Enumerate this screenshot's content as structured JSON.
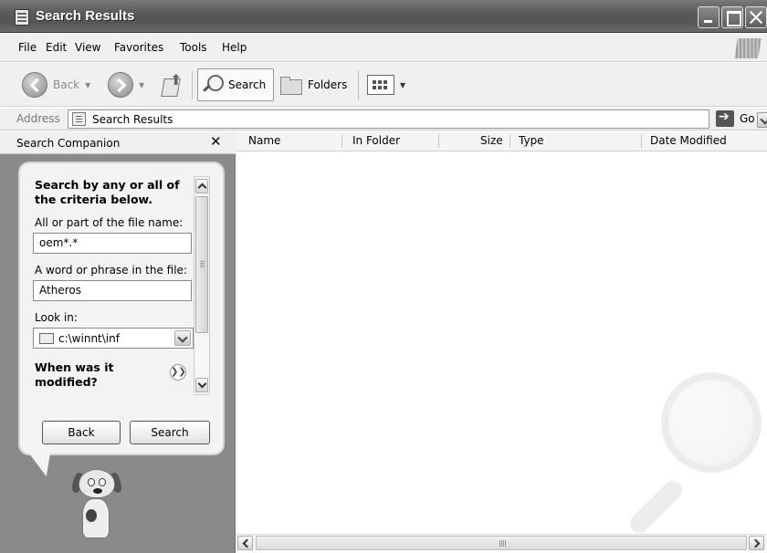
{
  "window": {
    "title": "Search Results"
  },
  "menu": {
    "items": [
      {
        "label": "File"
      },
      {
        "label": "Edit"
      },
      {
        "label": "View"
      },
      {
        "label": "Favorites"
      },
      {
        "label": "Tools"
      },
      {
        "label": "Help"
      }
    ]
  },
  "toolbar": {
    "back_label": "Back",
    "search_label": "Search",
    "folders_label": "Folders"
  },
  "address": {
    "label": "Address",
    "value": "Search Results",
    "go_label": "Go"
  },
  "panel": {
    "title": "Search Companion",
    "close_label": "✕",
    "criteria_title": "Search by any or all of the criteria below.",
    "filename_label": "All or part of the file name:",
    "filename_value": "oem*.*",
    "phrase_label": "A word or phrase in the file:",
    "phrase_value": "Atheros",
    "lookin_label": "Look in:",
    "lookin_value": "c:\\winnt\\inf",
    "when_label": "When was it modified?",
    "back_button": "Back",
    "search_button": "Search"
  },
  "columns": [
    "Name",
    "In Folder",
    "Size",
    "Type",
    "Date Modified"
  ],
  "icons": [
    "app-icon",
    "minimize-icon",
    "maximize-icon",
    "close-icon",
    "back-arrow-icon",
    "forward-arrow-icon",
    "up-folder-icon",
    "search-icon",
    "folders-icon",
    "views-icon",
    "address-page-icon",
    "go-arrow-icon",
    "folder-icon",
    "expand-icon",
    "dog-icon",
    "magnifier-watermark-icon"
  ]
}
